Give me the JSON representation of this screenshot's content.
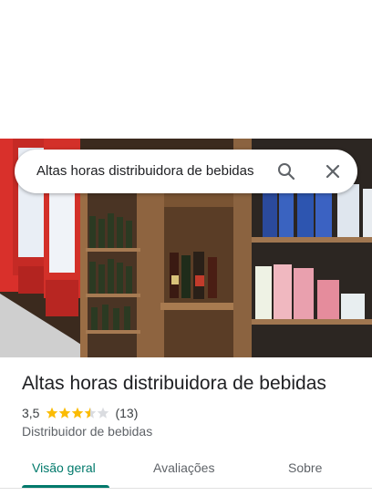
{
  "search": {
    "query": "Altas horas distribuidora de bebidas"
  },
  "place": {
    "name": "Altas horas distribuidora de bebidas",
    "rating": "3,5",
    "rating_value": 3.5,
    "review_count": "(13)",
    "category": "Distribuidor de bebidas"
  },
  "tabs": [
    {
      "label": "Visão geral",
      "active": true
    },
    {
      "label": "Avaliações",
      "active": false
    },
    {
      "label": "Sobre",
      "active": false
    }
  ],
  "colors": {
    "accent": "#00796b",
    "star": "#fbbc04",
    "star_empty": "#dadce0"
  },
  "icons": {
    "search": "search-icon",
    "close": "close-icon"
  }
}
